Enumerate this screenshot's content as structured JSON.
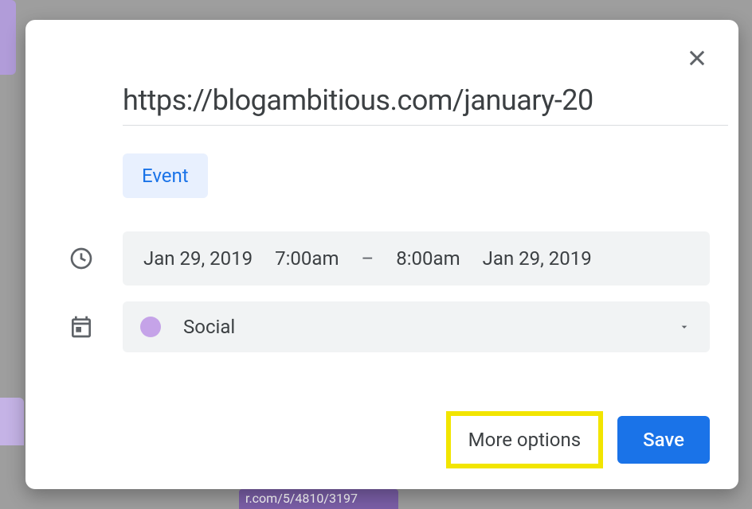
{
  "background": {
    "partial_text": "r.com/5/4810/3197"
  },
  "modal": {
    "title": "https://blogambitious.com/january-20",
    "type_tab": "Event",
    "datetime": {
      "start_date": "Jan 29, 2019",
      "start_time": "7:00am",
      "separator": "–",
      "end_time": "8:00am",
      "end_date": "Jan 29, 2019"
    },
    "calendar": {
      "name": "Social",
      "color": "#c5a3e8"
    },
    "buttons": {
      "more_options": "More options",
      "save": "Save"
    }
  }
}
